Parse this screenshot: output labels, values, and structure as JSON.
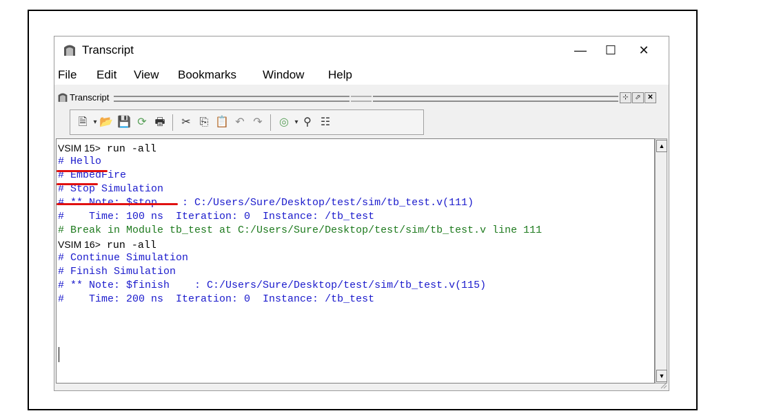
{
  "window": {
    "title": "Transcript",
    "controls": {
      "minimize": "—",
      "maximize": "☐",
      "close": "✕"
    }
  },
  "menu": [
    "File",
    "Edit",
    "View",
    "Bookmarks",
    "Window",
    "Help"
  ],
  "panel": {
    "title": "Transcript",
    "buttons": [
      "⊹",
      "⬀",
      "✕"
    ]
  },
  "toolbar": {
    "icons": [
      "new-file-icon",
      "open-folder-icon",
      "save-icon",
      "reload-icon",
      "print-icon",
      "cut-icon",
      "copy-icon",
      "paste-icon",
      "undo-icon",
      "redo-icon",
      "clear-icon",
      "find-icon",
      "format-icon"
    ]
  },
  "transcript": {
    "lines": [
      {
        "prompt": "VSIM 15>",
        "text": " run -all",
        "color": "black"
      },
      {
        "text": "# Hello",
        "color": "blue"
      },
      {
        "text": "# EmbedFire",
        "color": "blue"
      },
      {
        "text": "# Stop Simulation",
        "color": "blue"
      },
      {
        "text": "# ** Note: $stop    : C:/Users/Sure/Desktop/test/sim/tb_test.v(111)",
        "color": "blue"
      },
      {
        "text": "#    Time: 100 ns  Iteration: 0  Instance: /tb_test",
        "color": "blue"
      },
      {
        "text": "# Break in Module tb_test at C:/Users/Sure/Desktop/test/sim/tb_test.v line 111",
        "color": "green"
      },
      {
        "prompt": "VSIM 16>",
        "text": " run -all",
        "color": "black"
      },
      {
        "text": "# Continue Simulation",
        "color": "blue"
      },
      {
        "text": "# Finish Simulation",
        "color": "blue"
      },
      {
        "text": "# ** Note: $finish    : C:/Users/Sure/Desktop/test/sim/tb_test.v(115)",
        "color": "blue"
      },
      {
        "text": "#    Time: 200 ns  Iteration: 0  Instance: /tb_test",
        "color": "blue"
      }
    ]
  },
  "colors": {
    "blue": "#1a1acc",
    "green": "#1e7a1e",
    "annotation": "#e01010"
  }
}
